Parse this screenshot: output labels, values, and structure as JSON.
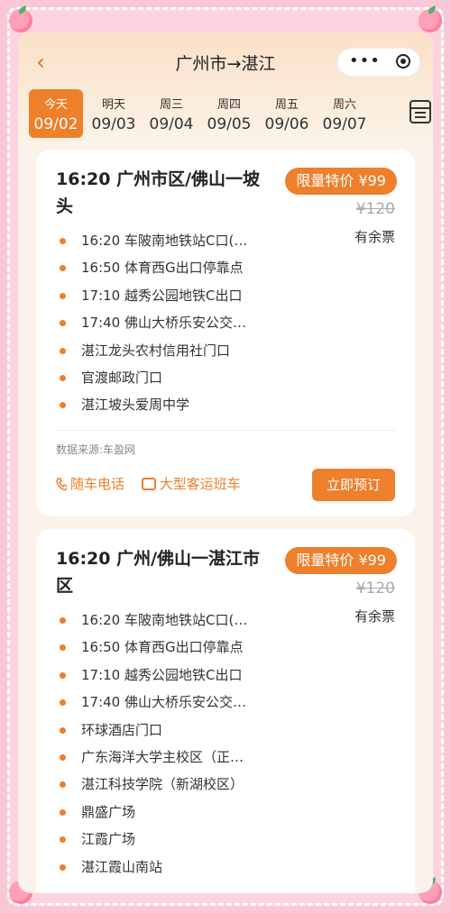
{
  "nav": {
    "title": "广州市→湛江"
  },
  "dates": [
    {
      "day": "今天",
      "date": "09/02",
      "active": true
    },
    {
      "day": "明天",
      "date": "09/03"
    },
    {
      "day": "周三",
      "date": "09/04"
    },
    {
      "day": "周四",
      "date": "09/05"
    },
    {
      "day": "周五",
      "date": "09/06"
    },
    {
      "day": "周六",
      "date": "09/07"
    }
  ],
  "cards": [
    {
      "title": "16:20 广州市区/佛山一坡头",
      "price_tag": "限量特价 ¥99",
      "old_price": "¥120",
      "availability": "有余票",
      "stops": [
        "16:20 车陂南地铁站C口(…",
        "16:50 体育西G出口停靠点",
        "17:10 越秀公园地铁C出口",
        "17:40 佛山大桥乐安公交…",
        "湛江龙头农村信用社门口",
        "官渡邮政门口",
        "湛江坡头爱周中学"
      ],
      "source": "数据来源:车盈网",
      "phone_label": "随车电话",
      "bus_label": "大型客运班车",
      "book_label": "立即预订"
    },
    {
      "title": "16:20 广州/佛山一湛江市区",
      "price_tag": "限量特价 ¥99",
      "old_price": "¥120",
      "availability": "有余票",
      "stops": [
        "16:20 车陂南地铁站C口(…",
        "16:50 体育西G出口停靠点",
        "17:10 越秀公园地铁C出口",
        "17:40 佛山大桥乐安公交…",
        "环球酒店门口",
        "广东海洋大学主校区（正…",
        "湛江科技学院（新湖校区）",
        "鼎盛广场",
        "江霞广场",
        "湛江霞山南站"
      ]
    }
  ],
  "colors": {
    "accent": "#ee7f2b",
    "pink_frame": "#fbd3de"
  }
}
